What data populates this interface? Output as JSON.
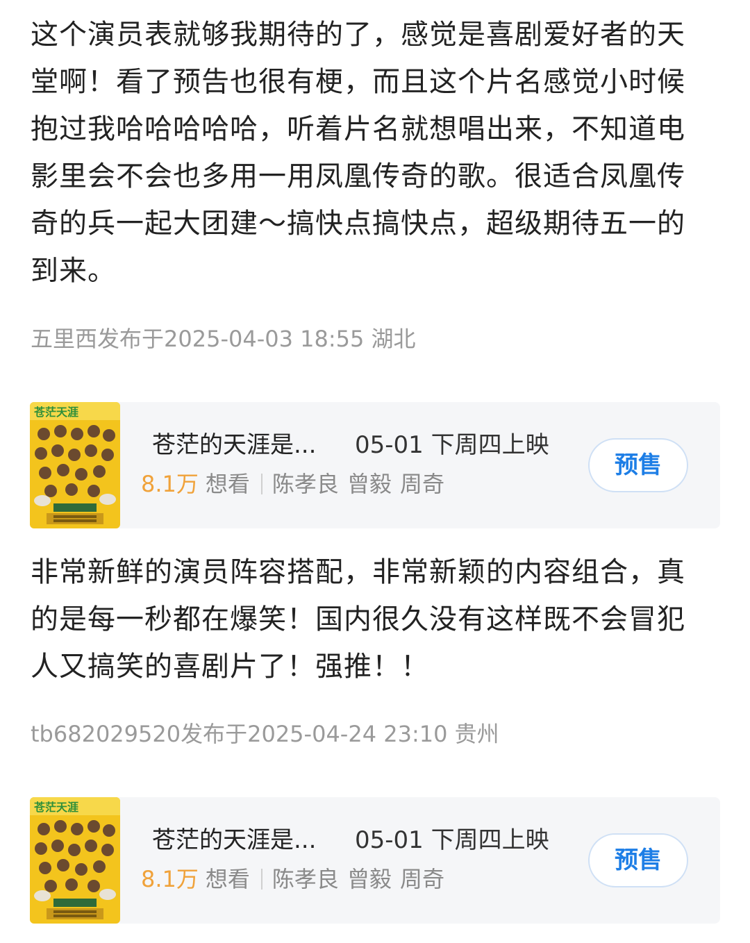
{
  "posts": [
    {
      "text": "这个演员表就够我期待的了，感觉是喜剧爱好者的天堂啊！看了预告也很有梗，而且这个片名感觉小时候抱过我哈哈哈哈哈，听着片名就想唱出来，不知道电影里会不会也多用一用凤凰传奇的歌。很适合凤凰传奇的兵一起大团建～搞快点搞快点，超级期待五一的到来。",
      "meta": "五里西发布于2025-04-03 18:55  湖北"
    },
    {
      "text": "非常新鲜的演员阵容搭配，非常新颖的内容组合，真的是每一秒都在爆笑！国内很久没有这样既不会冒犯人又搞笑的喜剧片了！强推！！",
      "meta": "tb682029520发布于2025-04-24 23:10  贵州"
    }
  ],
  "movie_card": {
    "title": "苍茫的天涯是...",
    "release": "05-01 下周四上映",
    "want_count": "8.1万",
    "want_label": "想看",
    "cast": [
      "陈孝良",
      "曾毅",
      "周奇"
    ],
    "presale_label": "预售",
    "poster_icon": "movie-poster-icon",
    "colors": {
      "accent": "#1d7ee6",
      "want": "#f0a23a",
      "poster_yellow": "#f3c41d",
      "poster_green": "#2f8f3a"
    }
  }
}
